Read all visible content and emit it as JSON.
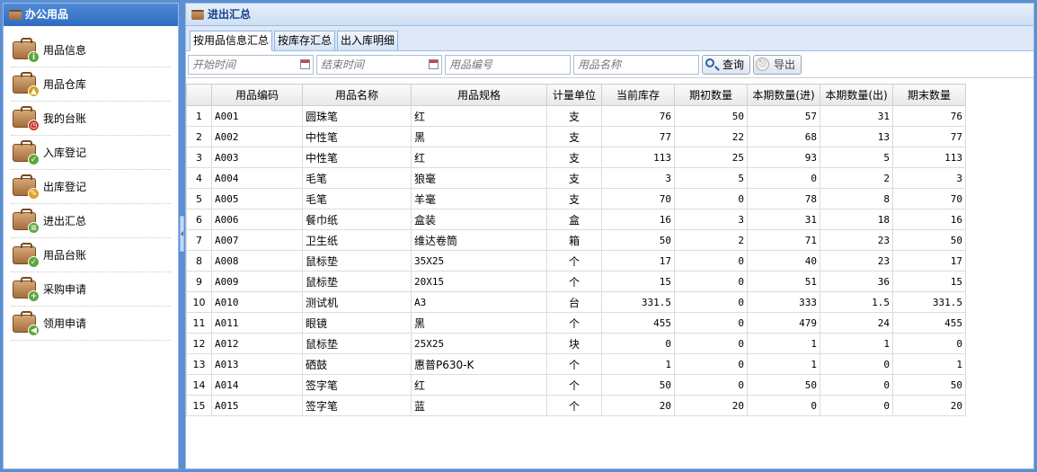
{
  "left": {
    "title": "办公用品",
    "items": [
      {
        "label": "用品信息",
        "badge": "i",
        "badge_color": "#5aa83a"
      },
      {
        "label": "用品仓库",
        "badge": "▲",
        "badge_color": "#d8a21e"
      },
      {
        "label": "我的台账",
        "badge": "◷",
        "badge_color": "#c9362c"
      },
      {
        "label": "入库登记",
        "badge": "✓",
        "badge_color": "#5aa83a"
      },
      {
        "label": "出库登记",
        "badge": "✎",
        "badge_color": "#e0a020"
      },
      {
        "label": "进出汇总",
        "badge": "≡",
        "badge_color": "#5aa83a"
      },
      {
        "label": "用品台账",
        "badge": "✓",
        "badge_color": "#5aa83a"
      },
      {
        "label": "采购申请",
        "badge": "+",
        "badge_color": "#5aa83a"
      },
      {
        "label": "领用申请",
        "badge": "◀",
        "badge_color": "#5aa83a"
      }
    ]
  },
  "main": {
    "title": "进出汇总",
    "tabs": [
      "按用品信息汇总",
      "按库存汇总",
      "出入库明细"
    ],
    "filters": {
      "start_placeholder": "开始时间",
      "end_placeholder": "结束时间",
      "code_placeholder": "用品编号",
      "name_placeholder": "用品名称"
    },
    "buttons": {
      "query": "查询",
      "export": "导出"
    }
  },
  "table": {
    "headers": [
      "用品编码",
      "用品名称",
      "用品规格",
      "计量单位",
      "当前库存",
      "期初数量",
      "本期数量(进)",
      "本期数量(出)",
      "期末数量"
    ],
    "rows": [
      [
        "1",
        "A001",
        "圆珠笔",
        "红",
        "支",
        "76",
        "50",
        "57",
        "31",
        "76"
      ],
      [
        "2",
        "A002",
        "中性笔",
        "黑",
        "支",
        "77",
        "22",
        "68",
        "13",
        "77"
      ],
      [
        "3",
        "A003",
        "中性笔",
        "红",
        "支",
        "113",
        "25",
        "93",
        "5",
        "113"
      ],
      [
        "4",
        "A004",
        "毛笔",
        "狼毫",
        "支",
        "3",
        "5",
        "0",
        "2",
        "3"
      ],
      [
        "5",
        "A005",
        "毛笔",
        "羊毫",
        "支",
        "70",
        "0",
        "78",
        "8",
        "70"
      ],
      [
        "6",
        "A006",
        "餐巾纸",
        "盒装",
        "盒",
        "16",
        "3",
        "31",
        "18",
        "16"
      ],
      [
        "7",
        "A007",
        "卫生纸",
        "维达卷筒",
        "箱",
        "50",
        "2",
        "71",
        "23",
        "50"
      ],
      [
        "8",
        "A008",
        "鼠标垫",
        "35X25",
        "个",
        "17",
        "0",
        "40",
        "23",
        "17"
      ],
      [
        "9",
        "A009",
        "鼠标垫",
        "20X15",
        "个",
        "15",
        "0",
        "51",
        "36",
        "15"
      ],
      [
        "10",
        "A010",
        "测试机",
        "A3",
        "台",
        "331.5",
        "0",
        "333",
        "1.5",
        "331.5"
      ],
      [
        "11",
        "A011",
        "眼镜",
        "黑",
        "个",
        "455",
        "0",
        "479",
        "24",
        "455"
      ],
      [
        "12",
        "A012",
        "鼠标垫",
        "25X25",
        "块",
        "0",
        "0",
        "1",
        "1",
        "0"
      ],
      [
        "13",
        "A013",
        "硒鼓",
        "惠普P630-K",
        "个",
        "1",
        "0",
        "1",
        "0",
        "1"
      ],
      [
        "14",
        "A014",
        "签字笔",
        "红",
        "个",
        "50",
        "0",
        "50",
        "0",
        "50"
      ],
      [
        "15",
        "A015",
        "签字笔",
        "蓝",
        "个",
        "20",
        "20",
        "0",
        "0",
        "20"
      ]
    ]
  }
}
